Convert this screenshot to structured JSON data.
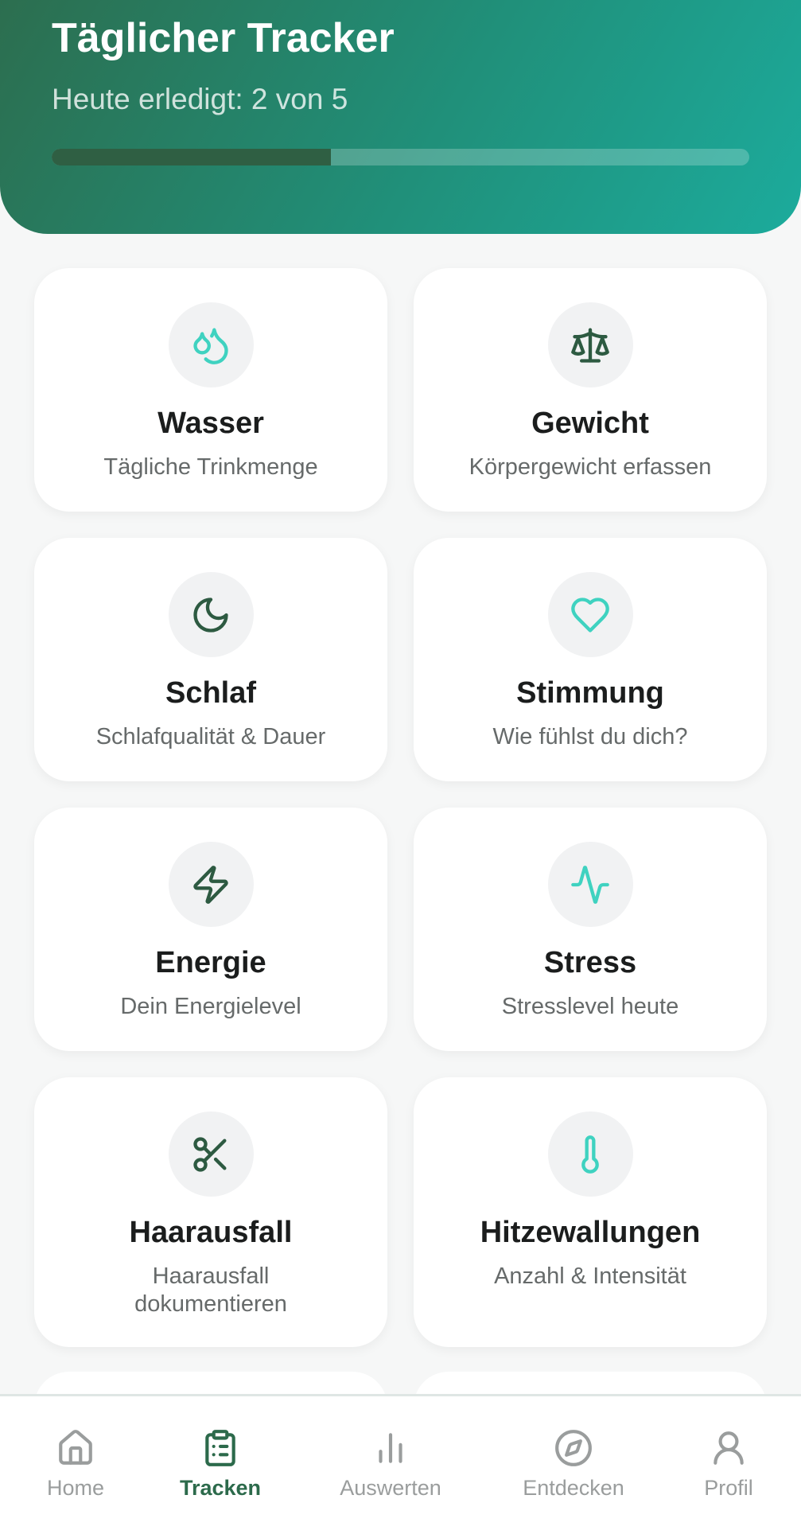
{
  "header": {
    "title": "Täglicher Tracker",
    "subtitle": "Heute erledigt: 2 von 5",
    "progress_fraction": 0.4
  },
  "trackers": [
    {
      "title": "Wasser",
      "subtitle": "Tägliche Trinkmenge",
      "icon": "droplets-icon"
    },
    {
      "title": "Gewicht",
      "subtitle": "Körpergewicht erfassen",
      "icon": "scale-icon"
    },
    {
      "title": "Schlaf",
      "subtitle": "Schlafqualität & Dauer",
      "icon": "moon-icon"
    },
    {
      "title": "Stimmung",
      "subtitle": "Wie fühlst du dich?",
      "icon": "heart-icon"
    },
    {
      "title": "Energie",
      "subtitle": "Dein Energielevel",
      "icon": "zap-icon"
    },
    {
      "title": "Stress",
      "subtitle": "Stresslevel heute",
      "icon": "activity-icon"
    },
    {
      "title": "Haarausfall",
      "subtitle": "Haarausfall dokumentieren",
      "icon": "scissors-icon"
    },
    {
      "title": "Hitzewallungen",
      "subtitle": "Anzahl & Intensität",
      "icon": "thermometer-icon"
    }
  ],
  "nav": {
    "items": [
      {
        "label": "Home",
        "icon": "home-icon",
        "active": false
      },
      {
        "label": "Tracken",
        "icon": "clipboard-icon",
        "active": true
      },
      {
        "label": "Auswerten",
        "icon": "bar-chart-icon",
        "active": false
      },
      {
        "label": "Entdecken",
        "icon": "compass-icon",
        "active": false
      },
      {
        "label": "Profil",
        "icon": "user-icon",
        "active": false
      }
    ]
  },
  "colors": {
    "teal_icon": "#3fd2c0",
    "dark_green_icon": "#2d5a41",
    "active_nav": "#2c6a4b",
    "inactive_nav": "#9a9d9d"
  }
}
